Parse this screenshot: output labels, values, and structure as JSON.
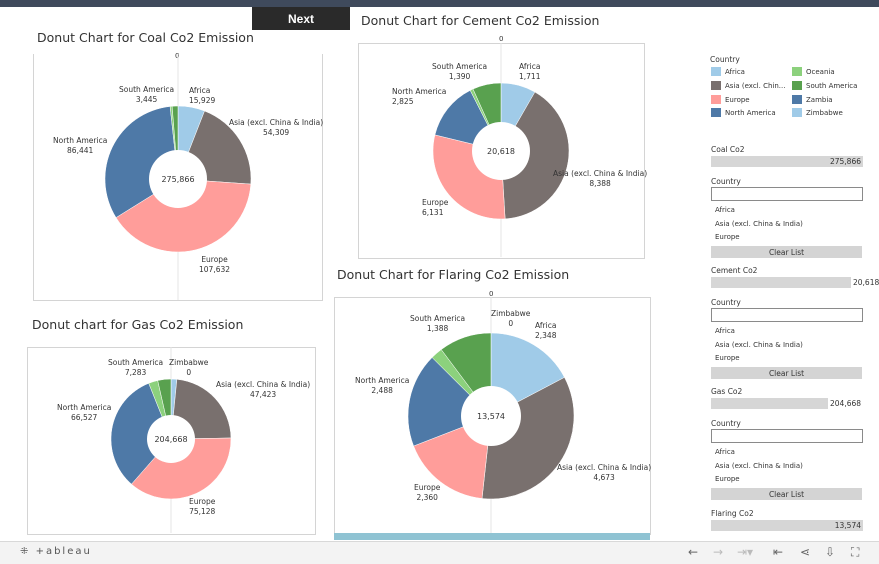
{
  "toolbar": {
    "next_label": "Next"
  },
  "colors": {
    "Africa": "#a0cbe8",
    "Asia (excl. China & India)": "#79706e",
    "Europe": "#ff9d9a",
    "North America": "#4e79a7",
    "Oceania": "#8cd17d",
    "South America": "#59a14f",
    "Zambia": "#4e79a7",
    "Zimbabwe": "#a0cbe8"
  },
  "charts": {
    "coal": {
      "title": "Donut Chart for Coal Co2 Emission",
      "total": "275,866",
      "zero": "0",
      "labels": [
        {
          "name": "Africa",
          "value": "15,929"
        },
        {
          "name": "Asia (excl. China & India)",
          "value": "54,309"
        },
        {
          "name": "Europe",
          "value": "107,632"
        },
        {
          "name": "North America",
          "value": "86,441"
        },
        {
          "name": "South America",
          "value": "3,445"
        }
      ]
    },
    "cement": {
      "title": "Donut Chart for Cement Co2 Emission",
      "total": "20,618",
      "zero": "0",
      "labels": [
        {
          "name": "Africa",
          "value": "1,711"
        },
        {
          "name": "Asia (excl. China & India)",
          "value": "8,388"
        },
        {
          "name": "Europe",
          "value": "6,131"
        },
        {
          "name": "North America",
          "value": "2,825"
        },
        {
          "name": "South America",
          "value": "1,390"
        }
      ]
    },
    "gas": {
      "title": "Donut chart for Gas Co2 Emission",
      "total": "204,668",
      "labels": [
        {
          "name": "Asia (excl. China & India)",
          "value": "47,423"
        },
        {
          "name": "Europe",
          "value": "75,128"
        },
        {
          "name": "North America",
          "value": "66,527"
        },
        {
          "name": "South America",
          "value": "7,283"
        },
        {
          "name": "Zimbabwe",
          "value": "0"
        }
      ]
    },
    "flaring": {
      "title": "Donut Chart for Flaring Co2 Emission",
      "total": "13,574",
      "zero": "0",
      "labels": [
        {
          "name": "Africa",
          "value": "2,348"
        },
        {
          "name": "Asia (excl. China & India)",
          "value": "4,673"
        },
        {
          "name": "Europe",
          "value": "2,360"
        },
        {
          "name": "North America",
          "value": "2,488"
        },
        {
          "name": "South America",
          "value": "1,388"
        },
        {
          "name": "Zimbabwe",
          "value": "0"
        }
      ]
    }
  },
  "chart_data": [
    {
      "type": "pie",
      "title": "Donut Chart for Coal Co2 Emission",
      "center_label": "275,866",
      "categories": [
        "Africa",
        "Asia (excl. China & India)",
        "Europe",
        "North America",
        "Oceania",
        "South America"
      ],
      "values": [
        15929,
        54309,
        107632,
        86441,
        1200,
        3445
      ]
    },
    {
      "type": "pie",
      "title": "Donut Chart for Cement Co2 Emission",
      "center_label": "20,618",
      "categories": [
        "Africa",
        "Asia (excl. China & India)",
        "Europe",
        "North America",
        "Oceania",
        "South America"
      ],
      "values": [
        1711,
        8388,
        6131,
        2825,
        150,
        1390
      ]
    },
    {
      "type": "pie",
      "title": "Donut chart for Gas Co2 Emission",
      "center_label": "204,668",
      "categories": [
        "Africa",
        "Asia (excl. China & India)",
        "Europe",
        "North America",
        "Oceania",
        "South America",
        "Zimbabwe"
      ],
      "values": [
        3200,
        47423,
        75128,
        66527,
        5100,
        7283,
        0
      ]
    },
    {
      "type": "pie",
      "title": "Donut Chart for Flaring Co2 Emission",
      "center_label": "13,574",
      "categories": [
        "Africa",
        "Asia (excl. China & India)",
        "Europe",
        "North America",
        "Oceania",
        "South America",
        "Zimbabwe"
      ],
      "values": [
        2348,
        4673,
        2360,
        2488,
        317,
        1388,
        0
      ]
    }
  ],
  "legend": {
    "title": "Country",
    "items": [
      {
        "label": "Africa",
        "color": "#a0cbe8"
      },
      {
        "label": "Oceania",
        "color": "#8cd17d"
      },
      {
        "label": "Asia (excl. Chin...",
        "color": "#79706e"
      },
      {
        "label": "South America",
        "color": "#59a14f"
      },
      {
        "label": "Europe",
        "color": "#ff9d9a"
      },
      {
        "label": "Zambia",
        "color": "#4e79a7"
      },
      {
        "label": "North America",
        "color": "#4e79a7"
      },
      {
        "label": "Zimbabwe",
        "color": "#a0cbe8"
      }
    ]
  },
  "filters": [
    {
      "label": "Coal Co2",
      "value": "275,866",
      "fill": 1.0,
      "country_label": "Country",
      "items": [
        "Africa",
        "Asia (excl. China & India)",
        "Europe"
      ],
      "clear": "Clear List"
    },
    {
      "label": "Cement Co2",
      "value": "20,618",
      "fill": 0.92,
      "country_label": "Country",
      "items": [
        "Africa",
        "Asia (excl. China & India)",
        "Europe"
      ],
      "clear": "Clear List"
    },
    {
      "label": "Gas Co2",
      "value": "204,668",
      "fill": 0.77,
      "country_label": "Country",
      "items": [
        "Africa",
        "Asia (excl. China & India)",
        "Europe"
      ],
      "clear": "Clear List"
    },
    {
      "label": "Flaring Co2",
      "value": "13,574",
      "fill": 1.0
    }
  ],
  "footer": {
    "logo": "+ableau"
  }
}
